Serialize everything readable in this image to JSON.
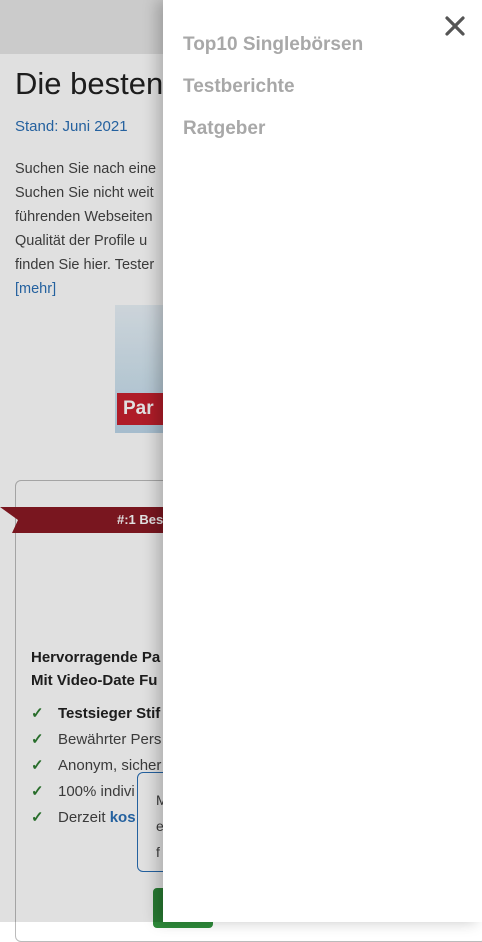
{
  "page": {
    "heading": "Die besten",
    "stand": "Stand: Juni 2021",
    "intro_lines": [
      "Suchen Sie nach eine",
      "Suchen Sie nicht weit",
      "führenden Webseiten",
      "Qualität der Profile u",
      "finden Sie hier. Tester"
    ],
    "more_link": "[mehr]",
    "banner_text": "Par",
    "ribbon": "#:1 Bes",
    "card_title": [
      "Hervorragende Pa",
      "Mit Video-Date Fu"
    ],
    "features": [
      {
        "text": "Testsieger Stif",
        "bold": true
      },
      {
        "text": "Bewährter Pers",
        "bold": false
      },
      {
        "text": "Anonym, sicher",
        "bold": false
      },
      {
        "text": "100% indivi",
        "bold": false
      },
      {
        "text": "Derzeit ",
        "link": "kos",
        "bold": false
      }
    ],
    "tooltip_lines": [
      "M",
      "e",
      "f"
    ],
    "colors": {
      "accent": "#2a6fb5",
      "ribbon": "#8a1a24",
      "check": "#2e7d32",
      "menu_text": "#a8a8a8"
    }
  },
  "drawer": {
    "close_icon": "close-icon",
    "items": [
      {
        "label": "Top10 Singlebörsen"
      },
      {
        "label": "Testberichte"
      },
      {
        "label": "Ratgeber"
      }
    ]
  }
}
